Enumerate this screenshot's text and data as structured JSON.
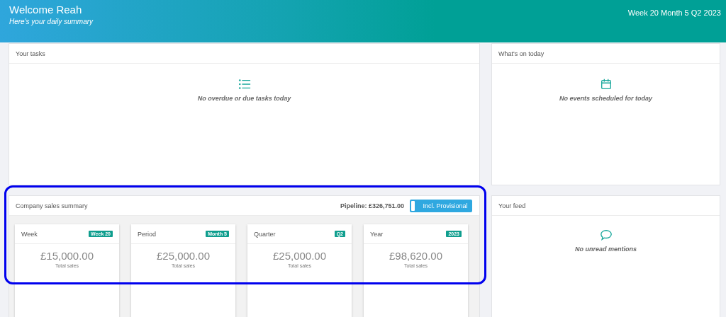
{
  "header": {
    "title": "Welcome Reah",
    "subtitle": "Here's your daily summary",
    "period": "Week 20 Month 5 Q2 2023"
  },
  "tasks": {
    "title": "Your tasks",
    "empty_message": "No overdue or due tasks today"
  },
  "events": {
    "title": "What's on today",
    "empty_message": "No events scheduled for today"
  },
  "sales_summary": {
    "title": "Company sales summary",
    "pipeline": "Pipeline: £326,751.00",
    "toggle": {
      "label": "Incl. Provisional",
      "on": true
    },
    "cards": [
      {
        "title": "Week",
        "badge": "Week 20",
        "amount": "£15,000.00",
        "caption": "Total sales"
      },
      {
        "title": "Period",
        "badge": "Month 5",
        "amount": "£25,000.00",
        "caption": "Total sales"
      },
      {
        "title": "Quarter",
        "badge": "Q2",
        "amount": "£25,000.00",
        "caption": "Total sales"
      },
      {
        "title": "Year",
        "badge": "2023",
        "amount": "£98,620.00",
        "caption": "Total sales"
      }
    ]
  },
  "feed": {
    "title": "Your feed",
    "empty_message": "No unread mentions"
  }
}
